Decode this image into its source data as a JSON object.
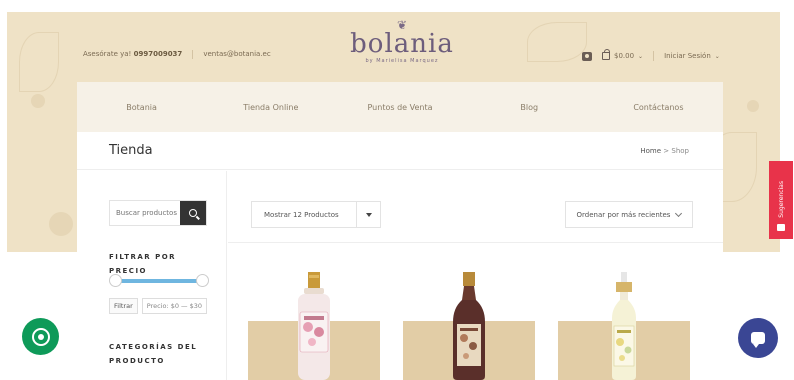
{
  "header": {
    "contact_phone_label": "Asesórate ya!",
    "contact_phone": "0997009037",
    "contact_email": "ventas@botania.ec",
    "logo_text": "bolania",
    "logo_byline": "by Marielisa Marquez",
    "cart_total": "$0.00",
    "login_label": "Iniciar Sesión"
  },
  "nav": {
    "items": [
      "Botania",
      "Tienda Online",
      "Puntos de Venta",
      "Blog",
      "Contáctanos"
    ]
  },
  "page": {
    "title": "Tienda",
    "breadcrumb_home": "Home",
    "breadcrumb_sep": ">",
    "breadcrumb_current": "Shop"
  },
  "sidebar": {
    "search_placeholder": "Buscar productos",
    "filter_title": "FILTRAR POR PRECIO",
    "filter_button": "Filtrar",
    "price_range": "Precio: $0 — $30",
    "categories_title": "CATEGORÍAS DEL PRODUCTO"
  },
  "toolbar": {
    "show_count": "Mostrar 12 Productos",
    "order_by": "Ordenar por más recientes"
  },
  "floating": {
    "suggestions_label": "Sugerencias"
  },
  "colors": {
    "hero_bg": "#efe2c6",
    "product_bg": "#e2cda6",
    "slider_accent": "#6fb6e0",
    "suggestions_red": "#e8334a",
    "whatsapp_green": "#0e9a59",
    "chat_blue": "#3a4694"
  },
  "icons": [
    "instagram-icon",
    "cart-icon",
    "search-icon",
    "whatsapp-icon",
    "chat-icon",
    "suggestions-icon"
  ]
}
